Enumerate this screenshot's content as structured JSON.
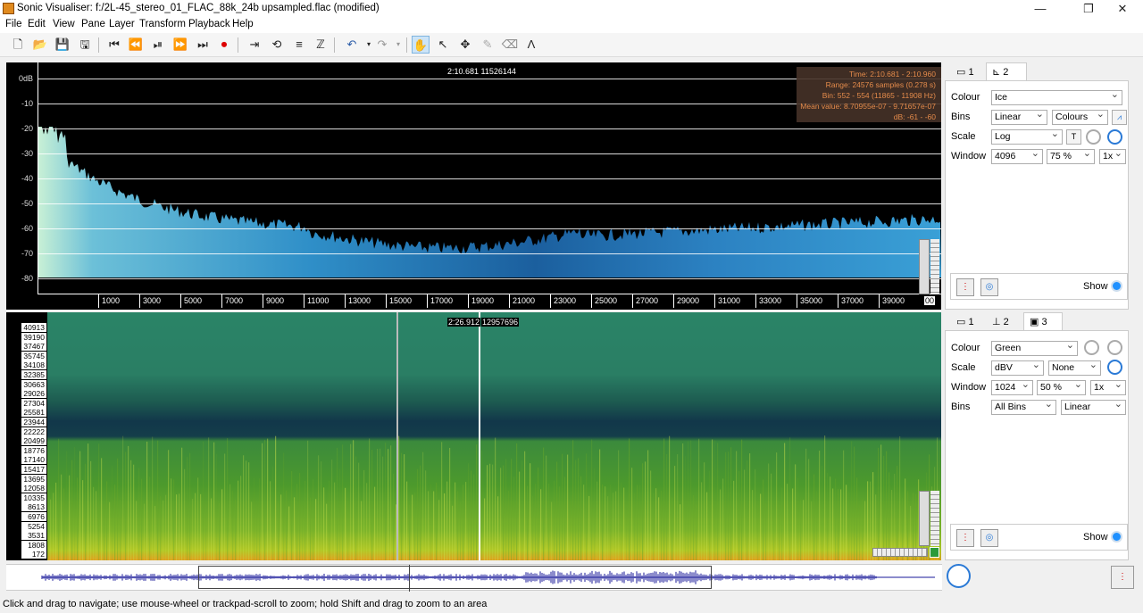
{
  "window": {
    "title": "Sonic Visualiser: f:/2L-45_stereo_01_FLAC_88k_24b upsampled.flac (modified)",
    "minimize": "—",
    "maximize": "❐",
    "close": "✕"
  },
  "menu": [
    "File",
    "Edit",
    "View",
    "Pane",
    "Layer",
    "Transform",
    "Playback",
    "Help"
  ],
  "toolbar_icons": [
    "new-file",
    "open-file",
    "save-file",
    "save-session",
    "rewind-start",
    "rewind",
    "play-pause",
    "fast-forward",
    "forward-end",
    "record",
    "play-selection",
    "loop",
    "solo",
    "constrain-playback",
    "undo",
    "redo",
    "navigate",
    "select",
    "move",
    "draw",
    "erase",
    "measure"
  ],
  "pane1": {
    "cursor_label": "2:10.681  11526144",
    "info": {
      "time": "Time: 2:10.681 - 2:10.960",
      "range": "Range: 24576 samples (0.278 s)",
      "bin": "Bin: 552 - 554 (11865 - 11908 Hz)",
      "mean": "Mean value: 8.70955e-07 - 9.71657e-07",
      "db": "dB: -61 - -60"
    },
    "y_labels": [
      "0dB",
      "-10",
      "-20",
      "-30",
      "-40",
      "-50",
      "-60",
      "-70",
      "-80"
    ],
    "x_labels": [
      "1000",
      "3000",
      "5000",
      "7000",
      "9000",
      "11000",
      "13000",
      "15000",
      "17000",
      "19000",
      "21000",
      "23000",
      "25000",
      "27000",
      "29000",
      "31000",
      "33000",
      "35000",
      "37000",
      "39000"
    ],
    "x_end_label": "00"
  },
  "pane2": {
    "cursor_time": "2:26.912",
    "cursor_sample": "12957696",
    "freq_labels": [
      "40913",
      "39190",
      "37467",
      "35745",
      "34108",
      "32385",
      "30663",
      "29026",
      "27304",
      "25581",
      "23944",
      "22222",
      "20499",
      "18776",
      "17140",
      "15417",
      "13695",
      "12058",
      "10335",
      "8613",
      "6976",
      "5254",
      "3531",
      "1808",
      "172"
    ]
  },
  "props1": {
    "tabs": [
      "1",
      "2"
    ],
    "selected_tab": "2",
    "colour_label": "Colour",
    "colour_value": "Ice",
    "bins_label": "Bins",
    "bins_value": "Linear",
    "bins_colours": "Colours",
    "scale_label": "Scale",
    "scale_value": "Log",
    "window_label": "Window",
    "window_size": "4096",
    "window_overlap": "75 %",
    "window_mult": "1x",
    "show_label": "Show"
  },
  "props2": {
    "tabs": [
      "1",
      "2",
      "3"
    ],
    "selected_tab": "3",
    "colour_label": "Colour",
    "colour_value": "Green",
    "scale_label": "Scale",
    "scale_value": "dBV",
    "scale_norm": "None",
    "window_label": "Window",
    "window_size": "1024",
    "window_overlap": "50 %",
    "window_mult": "1x",
    "bins_label": "Bins",
    "bins_value": "All Bins",
    "bins_scale": "Linear",
    "show_label": "Show"
  },
  "status": "Click and drag to navigate; use mouse-wheel or trackpad-scroll to zoom; hold Shift and drag to zoom to an area",
  "colors": {
    "spectrum_top": "#3aa7d8",
    "spectrum_low": "#a9e3cc",
    "spectrogram_bg": "#1f6e55",
    "spectrogram_hi": "#b6d12a",
    "waveform": "#1a1a9a",
    "info_text": "#e48b4b",
    "accent": "#2b7ad6"
  }
}
